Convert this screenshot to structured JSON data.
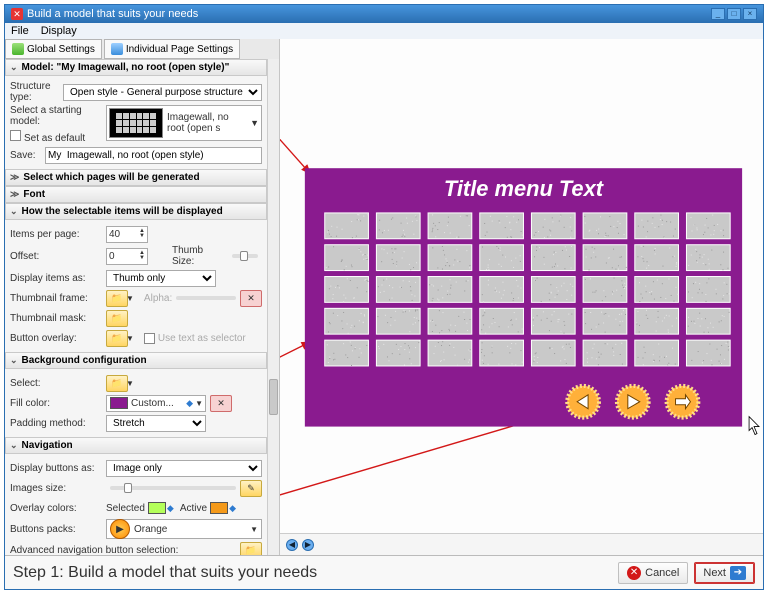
{
  "title": "Build a model that suits your needs",
  "menu": {
    "file": "File",
    "display": "Display"
  },
  "tabs": {
    "global": "Global Settings",
    "individual": "Individual Page Settings"
  },
  "sections": {
    "model_hdr": "Model: \"My  Imagewall, no root (open style)\"",
    "structure_type_lbl": "Structure type:",
    "structure_type_val": "Open style - General purpose structure",
    "select_starting_lbl": "Select a starting model:",
    "set_default_lbl": "Set as default",
    "model_name": "Imagewall, no root (open s",
    "save_lbl": "Save:",
    "save_val": "My  Imagewall, no root (open style)",
    "select_pages_hdr": "Select which pages will be generated",
    "font_hdr": "Font",
    "display_hdr": "How the selectable items will be displayed",
    "items_per_page_lbl": "Items per page:",
    "items_per_page_val": "40",
    "offset_lbl": "Offset:",
    "offset_val": "0",
    "thumb_size_lbl": "Thumb Size:",
    "display_items_lbl": "Display items as:",
    "display_items_val": "Thumb only",
    "thumb_frame_lbl": "Thumbnail frame:",
    "alpha_lbl": "Alpha:",
    "thumb_mask_lbl": "Thumbnail mask:",
    "button_overlay_lbl": "Button overlay:",
    "use_text_selector_lbl": "Use text as selector",
    "bg_hdr": "Background configuration",
    "select_lbl": "Select:",
    "fill_color_lbl": "Fill color:",
    "fill_color_val": "Custom...",
    "padding_lbl": "Padding method:",
    "padding_val": "Stretch",
    "nav_hdr": "Navigation",
    "display_buttons_lbl": "Display buttons as:",
    "display_buttons_val": "Image only",
    "images_size_lbl": "Images size:",
    "overlay_colors_lbl": "Overlay colors:",
    "selected_lbl": "Selected",
    "active_lbl": "Active",
    "buttons_packs_lbl": "Buttons packs:",
    "buttons_packs_val": "Orange",
    "adv_nav_lbl": "Advanced navigation button selection:"
  },
  "preview": {
    "title": "Title menu Text"
  },
  "footer": {
    "step": "Step 1: Build a model that suits your needs",
    "cancel": "Cancel",
    "next": "Next"
  },
  "colors": {
    "purple": "#8a1b8f",
    "orange": "#f59a1a",
    "green": "#b4ff5a"
  }
}
